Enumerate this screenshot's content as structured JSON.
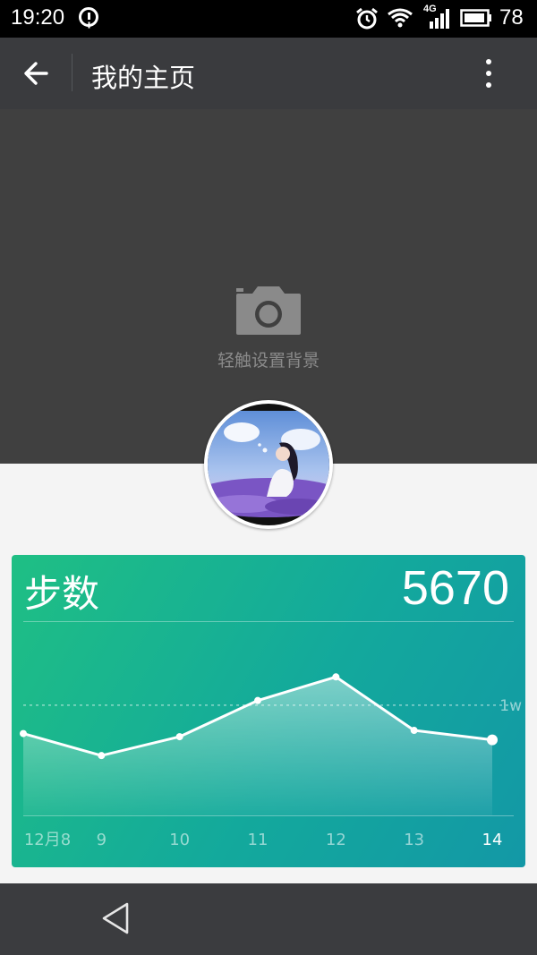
{
  "status_bar": {
    "time": "19:20",
    "network": "4G",
    "battery": "78"
  },
  "app_bar": {
    "title": "我的主页"
  },
  "cover": {
    "hint": "轻触设置背景"
  },
  "steps_card": {
    "title": "步数",
    "value": "5670",
    "reference_label": "1w",
    "colors": {
      "start": "#1fbf84",
      "end": "#1398a6"
    }
  },
  "chart_data": {
    "type": "area",
    "title": "步数",
    "categories": [
      "12月8",
      "9",
      "10",
      "11",
      "12",
      "13",
      "14"
    ],
    "series": [
      {
        "values": [
          5200,
          3800,
          5000,
          7300,
          8800,
          5400,
          4800
        ]
      }
    ],
    "reference_line": {
      "label": "1w",
      "value": 7000
    },
    "ylim": [
      0,
      12000
    ]
  },
  "nav_bar": {
    "back_icon": "triangle-back-icon"
  }
}
